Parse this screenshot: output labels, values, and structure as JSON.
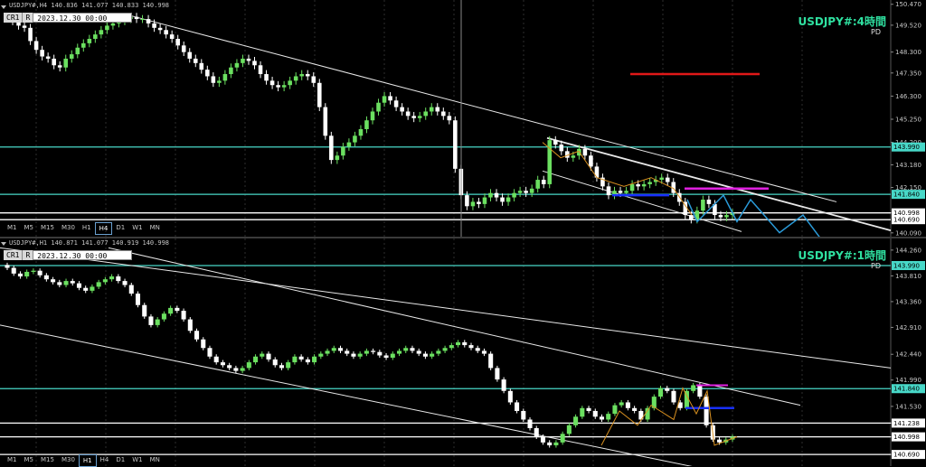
{
  "chart_data": [
    {
      "type": "candlestick",
      "symbol_header": "USDJPY#,H4  140.836 141.077 140.833 140.998",
      "crosshair_label": "CR1",
      "crosshair_r": "R",
      "crosshair_date": "2023.12.30 00:00",
      "title": "USDJPY#:4時間",
      "subtitle": "PD",
      "timeframes": [
        "M1",
        "M5",
        "M15",
        "M30",
        "H1",
        "H4",
        "D1",
        "W1",
        "MN"
      ],
      "active_timeframe": "H4",
      "ylim": [
        140.0,
        150.5
      ],
      "y_ticks": [
        "150.470",
        "149.520",
        "148.300",
        "147.350",
        "146.300",
        "145.250",
        "144.200",
        "143.180",
        "142.150",
        "141.000",
        "140.090"
      ],
      "price_tags": [
        {
          "label": "143.990",
          "value": 143.99,
          "color": "#48d8c8"
        },
        {
          "label": "141.840",
          "value": 141.84,
          "color": "#48d8c8"
        },
        {
          "label": "140.998",
          "value": 140.998,
          "color": "#ffffff"
        },
        {
          "label": "140.690",
          "value": 140.69,
          "color": "#ffffff"
        }
      ],
      "close_series": [
        149.7,
        149.5,
        149.4,
        148.8,
        148.4,
        148.1,
        148.0,
        147.7,
        147.6,
        148.0,
        148.2,
        148.5,
        148.7,
        148.9,
        149.1,
        149.3,
        149.5,
        149.6,
        149.7,
        149.8,
        149.9,
        149.8,
        149.8,
        149.6,
        149.4,
        149.3,
        149.1,
        148.9,
        148.6,
        148.3,
        148.0,
        147.8,
        147.5,
        147.2,
        146.9,
        147.0,
        147.3,
        147.6,
        147.8,
        148.0,
        147.9,
        147.7,
        147.3,
        147.0,
        146.8,
        146.7,
        146.8,
        147.0,
        147.2,
        147.3,
        147.2,
        146.9,
        145.8,
        144.5,
        143.4,
        143.6,
        144.0,
        144.2,
        144.5,
        144.8,
        145.2,
        145.6,
        146.0,
        146.3,
        146.1,
        145.8,
        145.6,
        145.4,
        145.3,
        145.4,
        145.6,
        145.8,
        145.6,
        145.4,
        145.2,
        143.0,
        141.8,
        141.3,
        141.5,
        141.4,
        141.7,
        141.9,
        141.7,
        141.5,
        141.7,
        141.9,
        142.0,
        141.9,
        142.1,
        142.5,
        142.3,
        144.3,
        144.1,
        143.8,
        143.5,
        143.6,
        143.9,
        143.6,
        143.1,
        142.6,
        142.2,
        141.8,
        142.0,
        141.9,
        142.0,
        142.3,
        142.2,
        142.3,
        142.4,
        142.5,
        142.6,
        142.4,
        141.9,
        141.5,
        140.9,
        140.7,
        141.1,
        141.6,
        141.4,
        140.9,
        140.8,
        140.9,
        141.0
      ]
    },
    {
      "type": "candlestick",
      "symbol_header": "USDJPY#,H1  140.871 141.077 140.919 140.998",
      "crosshair_label": "CR1",
      "crosshair_r": "R",
      "crosshair_date": "2023.12.30 00:00",
      "title": "USDJPY#:1時間",
      "subtitle": "PD",
      "timeframes": [
        "M1",
        "M5",
        "M15",
        "M30",
        "H1",
        "H4",
        "D1",
        "W1",
        "MN"
      ],
      "active_timeframe": "H1",
      "ylim": [
        140.55,
        144.4
      ],
      "y_ticks": [
        "144.260",
        "143.810",
        "143.360",
        "142.910",
        "142.440",
        "141.990",
        "141.530",
        "141.238",
        "140.998",
        "140.690"
      ],
      "price_tags": [
        {
          "label": "143.990",
          "value": 143.99,
          "color": "#48d8c8"
        },
        {
          "label": "141.840",
          "value": 141.84,
          "color": "#48d8c8"
        },
        {
          "label": "141.238",
          "value": 141.238,
          "color": "#ffffff"
        },
        {
          "label": "140.998",
          "value": 140.998,
          "color": "#ffffff"
        },
        {
          "label": "140.690",
          "value": 140.69,
          "color": "#ffffff"
        }
      ],
      "close_series": [
        143.95,
        143.85,
        143.8,
        143.88,
        143.9,
        143.82,
        143.75,
        143.7,
        143.65,
        143.72,
        143.68,
        143.6,
        143.55,
        143.62,
        143.7,
        143.75,
        143.8,
        143.72,
        143.65,
        143.5,
        143.3,
        143.1,
        142.95,
        143.05,
        143.15,
        143.25,
        143.2,
        143.05,
        142.85,
        142.7,
        142.55,
        142.4,
        142.3,
        142.25,
        142.2,
        142.15,
        142.2,
        142.3,
        142.4,
        142.45,
        142.35,
        142.25,
        142.2,
        142.3,
        142.4,
        142.35,
        142.3,
        142.4,
        142.45,
        142.5,
        142.55,
        142.5,
        142.45,
        142.4,
        142.45,
        142.5,
        142.48,
        142.42,
        142.38,
        142.45,
        142.5,
        142.55,
        142.5,
        142.45,
        142.4,
        142.45,
        142.5,
        142.55,
        142.6,
        142.65,
        142.6,
        142.55,
        142.5,
        142.45,
        142.2,
        142.0,
        141.8,
        141.6,
        141.45,
        141.3,
        141.15,
        141.0,
        140.9,
        140.85,
        140.9,
        141.05,
        141.2,
        141.35,
        141.5,
        141.45,
        141.35,
        141.3,
        141.4,
        141.55,
        141.6,
        141.5,
        141.45,
        141.3,
        141.5,
        141.7,
        141.85,
        141.8,
        141.6,
        141.5,
        141.8,
        141.9,
        141.7,
        141.2,
        140.95,
        140.9,
        140.95,
        141.0
      ]
    }
  ],
  "drawings": {
    "colors": {
      "up": "#6be060",
      "down": "#ffffff",
      "level": "#48d8c8",
      "trend": "#e8e8e8",
      "zigzag": "#2a9ad8",
      "red": "#e01818",
      "magenta": "#e020e0",
      "blue": "#1830ff",
      "candle_line": "#d89020"
    }
  }
}
